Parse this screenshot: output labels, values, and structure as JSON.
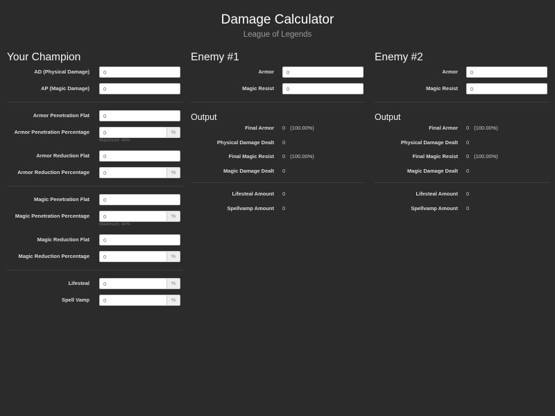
{
  "page": {
    "title": "Damage Calculator",
    "subtitle": "League of Legends"
  },
  "champion": {
    "heading": "Your Champion",
    "ad": {
      "label": "AD (Physical Damage)",
      "value": "0"
    },
    "ap": {
      "label": "AP (Magic Damage)",
      "value": "0"
    },
    "armor_pen_flat": {
      "label": "Armor Penetration Flat",
      "value": "0"
    },
    "armor_pen_pct": {
      "label": "Armor Penetration Percentage",
      "value": "0",
      "unit": "%",
      "help": "Maximum: 40%"
    },
    "armor_red_flat": {
      "label": "Armor Reduction Flat",
      "value": "0"
    },
    "armor_red_pct": {
      "label": "Armor Reduction Percentage",
      "value": "0",
      "unit": "%"
    },
    "magic_pen_flat": {
      "label": "Magic Penetration Flat",
      "value": "0"
    },
    "magic_pen_pct": {
      "label": "Magic Penetration Percentage",
      "value": "0",
      "unit": "%",
      "help": "Maximum: 40%"
    },
    "magic_red_flat": {
      "label": "Magic Reduction Flat",
      "value": "0"
    },
    "magic_red_pct": {
      "label": "Magic Reduction Percentage",
      "value": "0",
      "unit": "%"
    },
    "lifesteal": {
      "label": "Lifesteal",
      "value": "0",
      "unit": "%"
    },
    "spell_vamp": {
      "label": "Spell Vamp",
      "value": "0",
      "unit": "%"
    }
  },
  "enemy1": {
    "heading": "Enemy #1",
    "armor": {
      "label": "Armor",
      "value": "0"
    },
    "magic_resist": {
      "label": "Magic Resist",
      "value": "0"
    },
    "output_heading": "Output",
    "final_armor": {
      "label": "Final Armor",
      "value": "0",
      "pct": "(100.00%)"
    },
    "physical_dealt": {
      "label": "Physical Damage Dealt",
      "value": "0"
    },
    "final_mr": {
      "label": "Final Magic Resist",
      "value": "0",
      "pct": "(100.00%)"
    },
    "magic_dealt": {
      "label": "Magic Damage Dealt",
      "value": "0"
    },
    "lifesteal_amount": {
      "label": "Lifesteal Amount",
      "value": "0"
    },
    "spellvamp_amount": {
      "label": "Spellvamp Amount",
      "value": "0"
    }
  },
  "enemy2": {
    "heading": "Enemy #2",
    "armor": {
      "label": "Armor",
      "value": "0"
    },
    "magic_resist": {
      "label": "Magic Resist",
      "value": "0"
    },
    "output_heading": "Output",
    "final_armor": {
      "label": "Final Armor",
      "value": "0",
      "pct": "(100.00%)"
    },
    "physical_dealt": {
      "label": "Physical Damage Dealt",
      "value": "0"
    },
    "final_mr": {
      "label": "Final Magic Resist",
      "value": "0",
      "pct": "(100.00%)"
    },
    "magic_dealt": {
      "label": "Magic Damage Dealt",
      "value": "0"
    },
    "lifesteal_amount": {
      "label": "Lifesteal Amount",
      "value": "0"
    },
    "spellvamp_amount": {
      "label": "Spellvamp Amount",
      "value": "0"
    }
  },
  "colors": {
    "background": "#2b2b2b",
    "text": "#e6e6e6",
    "muted": "#6e6e6e",
    "input_bg": "#ffffff",
    "addon_bg": "#eeeeee"
  }
}
